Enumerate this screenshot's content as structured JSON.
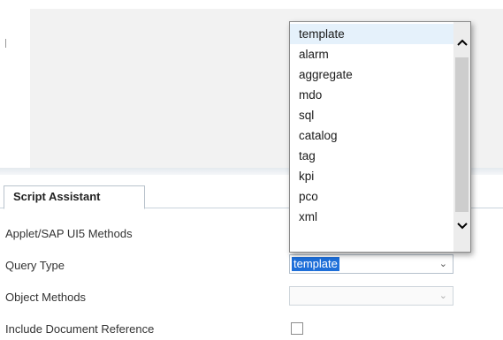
{
  "script_assistant": {
    "tab_label": "Script Assistant",
    "fields": {
      "applet_methods_label": "Applet/SAP UI5 Methods",
      "query_type_label": "Query Type",
      "query_type_value": "template",
      "object_methods_label": "Object Methods",
      "object_methods_value": "",
      "include_doc_ref_label": "Include Document Reference",
      "include_doc_ref_checked": false
    }
  },
  "query_type_dropdown": {
    "options": [
      "template",
      "alarm",
      "aggregate",
      "mdo",
      "sql",
      "catalog",
      "tag",
      "kpi",
      "pco",
      "xml"
    ],
    "highlighted": "template"
  }
}
